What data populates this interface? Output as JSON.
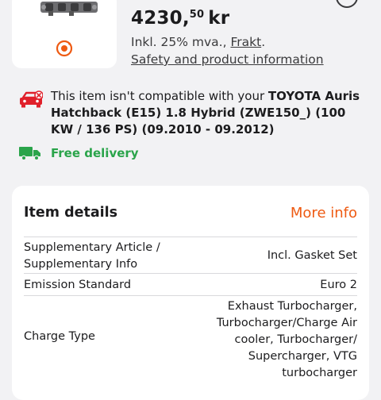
{
  "product": {
    "price_main": "4230,",
    "price_cents": "50",
    "price_currency": "kr",
    "vat_prefix": "Inkl. 25% mva., ",
    "shipping_link": "Frakt",
    "vat_suffix": ".",
    "safety_link": "Safety and product information"
  },
  "compatibility": {
    "text_prefix": "This item isn't compatible with your ",
    "vehicle": "TOYOTA Auris",
    "details": "Hatchback (E15) 1.8 Hybrid (ZWE150_) (100 KW / 136 PS) (09.2010 - 09.2012)"
  },
  "delivery": {
    "text": "Free delivery"
  },
  "item_details": {
    "title": "Item details",
    "more_info": "More info",
    "rows": [
      {
        "label_line1": "Supplementary Article /",
        "label_line2": "Supplementary Info",
        "value": "Incl. Gasket Set"
      },
      {
        "label": "Emission Standard",
        "value": "Euro 2"
      },
      {
        "label": "Charge Type",
        "value_lines": [
          "Exhaust Turbocharger,",
          "Turbocharger/Charge Air",
          "cooler, Turbocharger/",
          "Supercharger, VTG",
          "turbocharger"
        ]
      }
    ]
  },
  "colors": {
    "accent": "#ee5a12",
    "success": "#2aa44a",
    "warning": "#e0202a"
  },
  "icons": [
    "product-part-image",
    "360-view-icon",
    "incompatible-car-icon",
    "delivery-truck-icon"
  ]
}
